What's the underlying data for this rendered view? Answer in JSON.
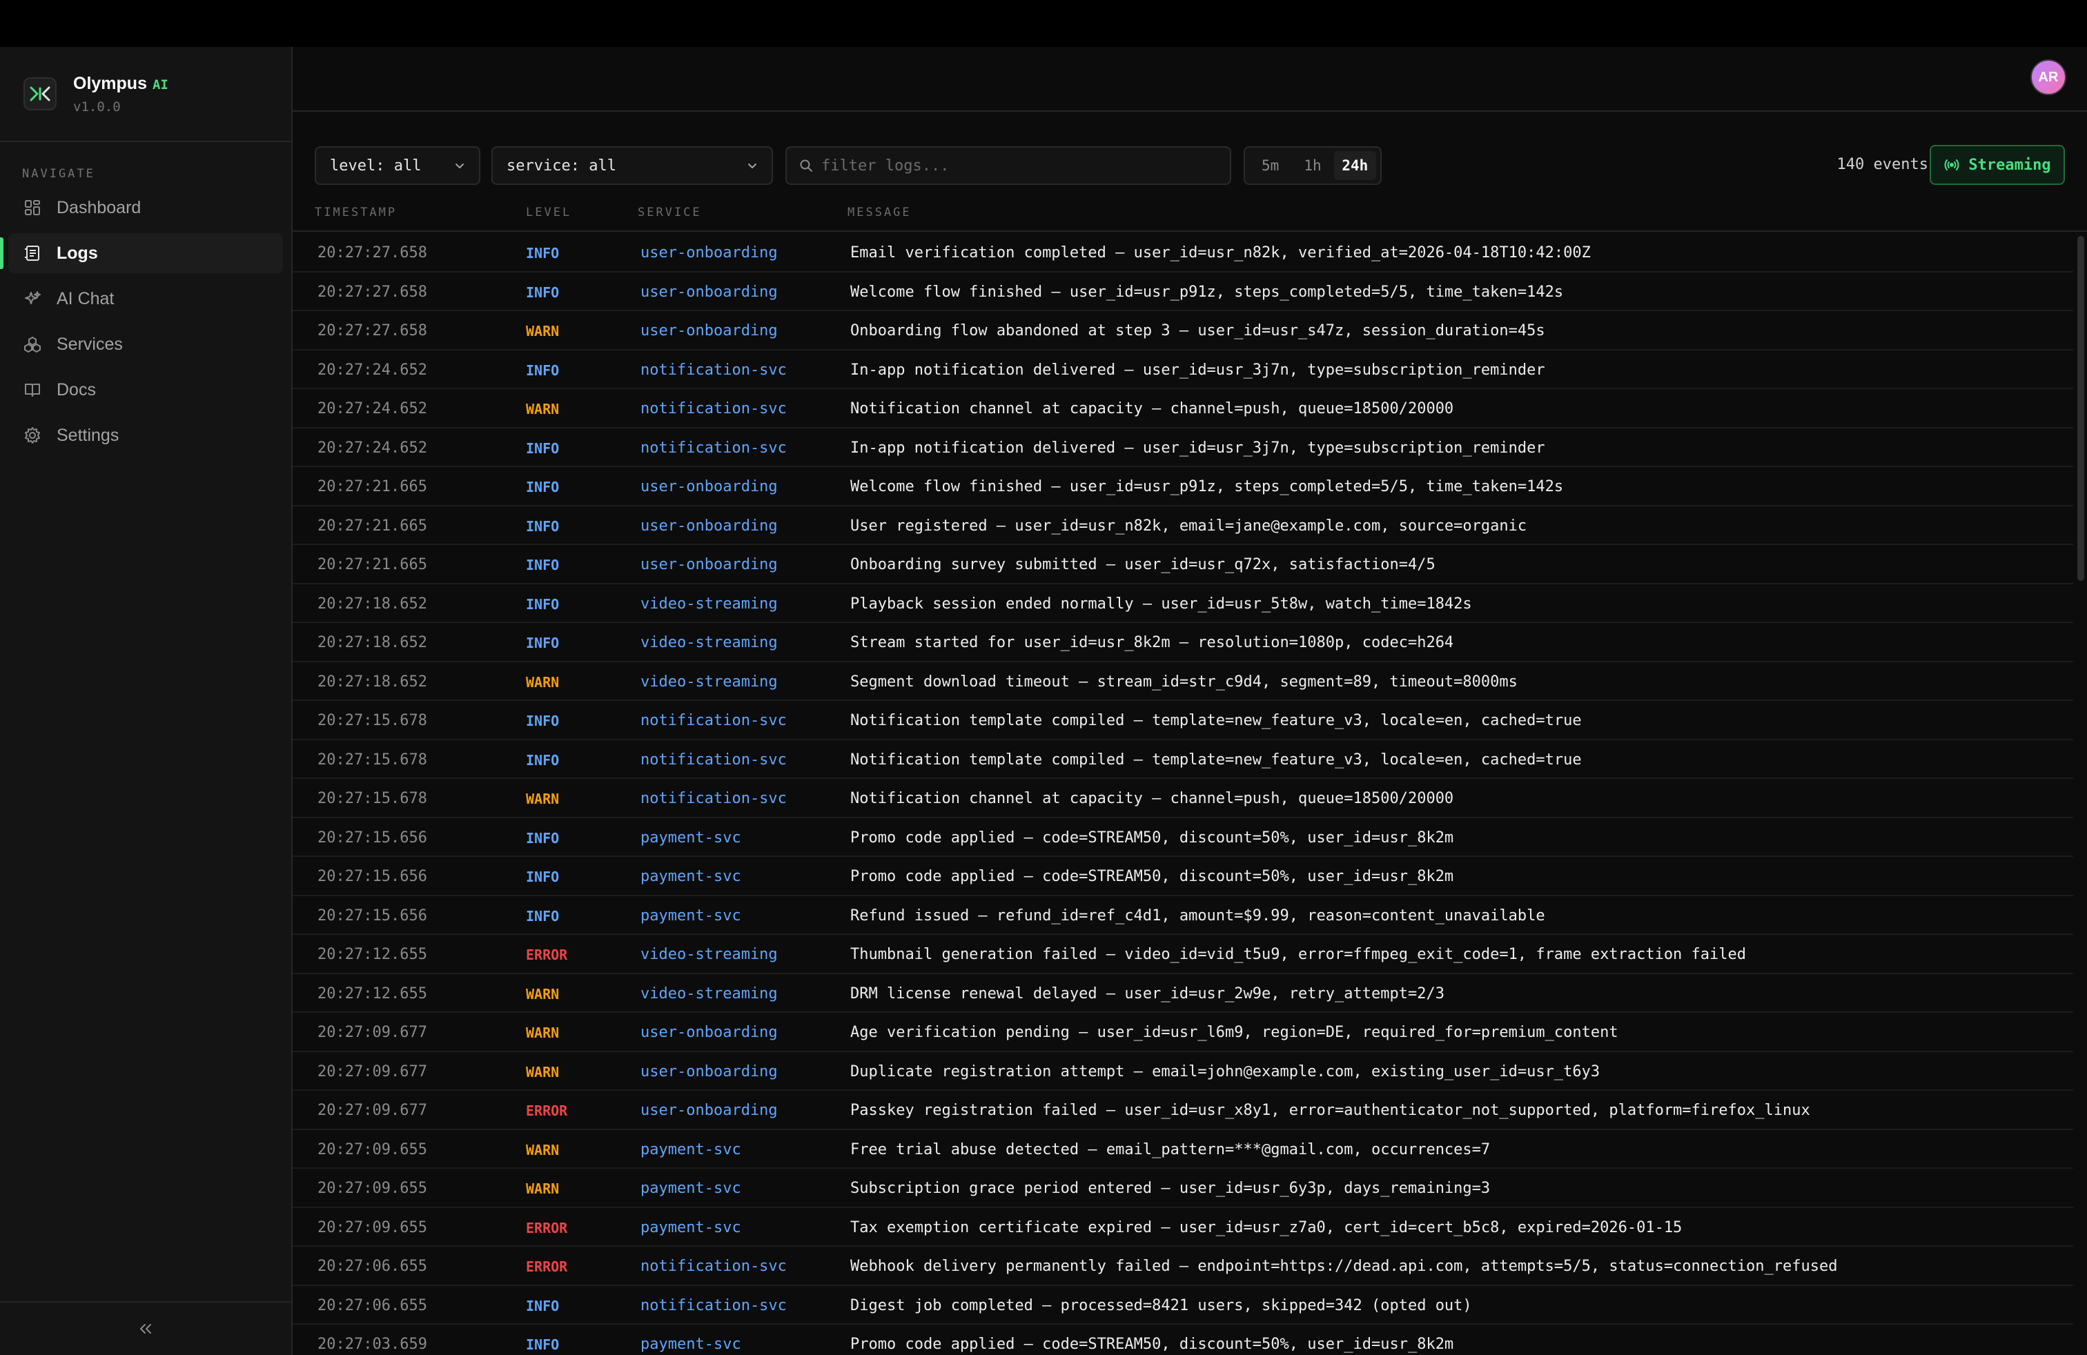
{
  "brand": {
    "name": "Olympus",
    "ai_tag": "AI",
    "version": "v1.0.0"
  },
  "nav": {
    "heading": "NAVIGATE",
    "items": [
      {
        "label": "Dashboard",
        "icon": "dashboard-icon"
      },
      {
        "label": "Logs",
        "icon": "logs-icon",
        "active": true
      },
      {
        "label": "AI Chat",
        "icon": "sparkles-icon"
      },
      {
        "label": "Services",
        "icon": "services-icon"
      },
      {
        "label": "Docs",
        "icon": "book-icon"
      },
      {
        "label": "Settings",
        "icon": "gear-icon"
      }
    ],
    "collapse_label": "«"
  },
  "user": {
    "initials": "AR"
  },
  "filters": {
    "level": "level: all",
    "service": "service: all",
    "search_placeholder": "filter logs...",
    "ranges": [
      "5m",
      "1h",
      "24h"
    ],
    "active_range": "24h",
    "event_count": "140 events",
    "stream_label": "Streaming"
  },
  "columns": {
    "timestamp": "TIMESTAMP",
    "level": "LEVEL",
    "service": "SERVICE",
    "message": "MESSAGE"
  },
  "logs": [
    {
      "ts": "20:27:27.658",
      "level": "INFO",
      "service": "user-onboarding",
      "msg": "Email verification completed — user_id=usr_n82k, verified_at=2026-04-18T10:42:00Z"
    },
    {
      "ts": "20:27:27.658",
      "level": "INFO",
      "service": "user-onboarding",
      "msg": "Welcome flow finished — user_id=usr_p91z, steps_completed=5/5, time_taken=142s"
    },
    {
      "ts": "20:27:27.658",
      "level": "WARN",
      "service": "user-onboarding",
      "msg": "Onboarding flow abandoned at step 3 — user_id=usr_s47z, session_duration=45s"
    },
    {
      "ts": "20:27:24.652",
      "level": "INFO",
      "service": "notification-svc",
      "msg": "In-app notification delivered — user_id=usr_3j7n, type=subscription_reminder"
    },
    {
      "ts": "20:27:24.652",
      "level": "WARN",
      "service": "notification-svc",
      "msg": "Notification channel at capacity — channel=push, queue=18500/20000"
    },
    {
      "ts": "20:27:24.652",
      "level": "INFO",
      "service": "notification-svc",
      "msg": "In-app notification delivered — user_id=usr_3j7n, type=subscription_reminder"
    },
    {
      "ts": "20:27:21.665",
      "level": "INFO",
      "service": "user-onboarding",
      "msg": "Welcome flow finished — user_id=usr_p91z, steps_completed=5/5, time_taken=142s"
    },
    {
      "ts": "20:27:21.665",
      "level": "INFO",
      "service": "user-onboarding",
      "msg": "User registered — user_id=usr_n82k, email=jane@example.com, source=organic"
    },
    {
      "ts": "20:27:21.665",
      "level": "INFO",
      "service": "user-onboarding",
      "msg": "Onboarding survey submitted — user_id=usr_q72x, satisfaction=4/5"
    },
    {
      "ts": "20:27:18.652",
      "level": "INFO",
      "service": "video-streaming",
      "msg": "Playback session ended normally — user_id=usr_5t8w, watch_time=1842s"
    },
    {
      "ts": "20:27:18.652",
      "level": "INFO",
      "service": "video-streaming",
      "msg": "Stream started for user_id=usr_8k2m — resolution=1080p, codec=h264"
    },
    {
      "ts": "20:27:18.652",
      "level": "WARN",
      "service": "video-streaming",
      "msg": "Segment download timeout — stream_id=str_c9d4, segment=89, timeout=8000ms"
    },
    {
      "ts": "20:27:15.678",
      "level": "INFO",
      "service": "notification-svc",
      "msg": "Notification template compiled — template=new_feature_v3, locale=en, cached=true"
    },
    {
      "ts": "20:27:15.678",
      "level": "INFO",
      "service": "notification-svc",
      "msg": "Notification template compiled — template=new_feature_v3, locale=en, cached=true"
    },
    {
      "ts": "20:27:15.678",
      "level": "WARN",
      "service": "notification-svc",
      "msg": "Notification channel at capacity — channel=push, queue=18500/20000"
    },
    {
      "ts": "20:27:15.656",
      "level": "INFO",
      "service": "payment-svc",
      "msg": "Promo code applied — code=STREAM50, discount=50%, user_id=usr_8k2m"
    },
    {
      "ts": "20:27:15.656",
      "level": "INFO",
      "service": "payment-svc",
      "msg": "Promo code applied — code=STREAM50, discount=50%, user_id=usr_8k2m"
    },
    {
      "ts": "20:27:15.656",
      "level": "INFO",
      "service": "payment-svc",
      "msg": "Refund issued — refund_id=ref_c4d1, amount=$9.99, reason=content_unavailable"
    },
    {
      "ts": "20:27:12.655",
      "level": "ERROR",
      "service": "video-streaming",
      "msg": "Thumbnail generation failed — video_id=vid_t5u9, error=ffmpeg_exit_code=1, frame extraction failed"
    },
    {
      "ts": "20:27:12.655",
      "level": "WARN",
      "service": "video-streaming",
      "msg": "DRM license renewal delayed — user_id=usr_2w9e, retry_attempt=2/3"
    },
    {
      "ts": "20:27:09.677",
      "level": "WARN",
      "service": "user-onboarding",
      "msg": "Age verification pending — user_id=usr_l6m9, region=DE, required_for=premium_content"
    },
    {
      "ts": "20:27:09.677",
      "level": "WARN",
      "service": "user-onboarding",
      "msg": "Duplicate registration attempt — email=john@example.com, existing_user_id=usr_t6y3"
    },
    {
      "ts": "20:27:09.677",
      "level": "ERROR",
      "service": "user-onboarding",
      "msg": "Passkey registration failed — user_id=usr_x8y1, error=authenticator_not_supported, platform=firefox_linux"
    },
    {
      "ts": "20:27:09.655",
      "level": "WARN",
      "service": "payment-svc",
      "msg": "Free trial abuse detected — email_pattern=***@gmail.com, occurrences=7"
    },
    {
      "ts": "20:27:09.655",
      "level": "WARN",
      "service": "payment-svc",
      "msg": "Subscription grace period entered — user_id=usr_6y3p, days_remaining=3"
    },
    {
      "ts": "20:27:09.655",
      "level": "ERROR",
      "service": "payment-svc",
      "msg": "Tax exemption certificate expired — user_id=usr_z7a0, cert_id=cert_b5c8, expired=2026-01-15"
    },
    {
      "ts": "20:27:06.655",
      "level": "ERROR",
      "service": "notification-svc",
      "msg": "Webhook delivery permanently failed — endpoint=https://dead.api.com, attempts=5/5, status=connection_refused"
    },
    {
      "ts": "20:27:06.655",
      "level": "INFO",
      "service": "notification-svc",
      "msg": "Digest job completed — processed=8421 users, skipped=342 (opted out)"
    },
    {
      "ts": "20:27:03.659",
      "level": "INFO",
      "service": "payment-svc",
      "msg": "Promo code applied — code=STREAM50, discount=50%, user_id=usr_8k2m"
    }
  ]
}
